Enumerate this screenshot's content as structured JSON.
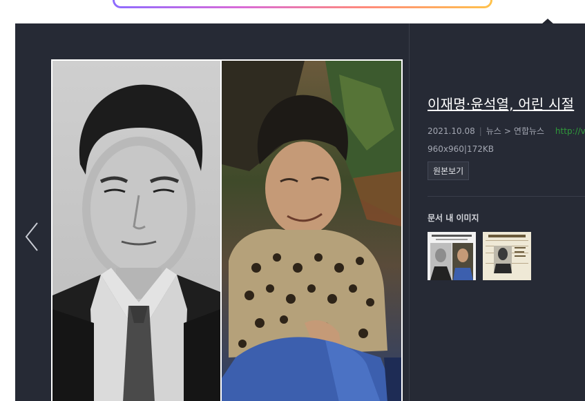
{
  "document": {
    "title": "이재명·윤석열, 어린 시절",
    "date": "2021.10.08",
    "category": "뉴스",
    "source": "연합뉴스",
    "url": "http://v.me",
    "dimensions": "960x960",
    "file_size": "172KB",
    "original_button_label": "원본보기"
  },
  "related": {
    "title": "문서 내 이미지",
    "thumbnails": [
      "thumbnail-1",
      "thumbnail-2"
    ]
  },
  "icons": {
    "prev": "chevron-left-icon"
  },
  "colors": {
    "viewer_bg": "#262a35",
    "url_green": "#2f9a3a",
    "accent_gradient": [
      "#8d6bff",
      "#d86ad8",
      "#ff8a7a",
      "#ffc24b"
    ]
  }
}
